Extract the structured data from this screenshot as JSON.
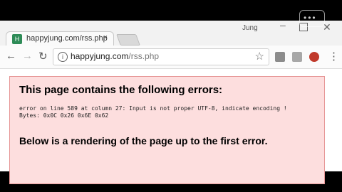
{
  "tab": {
    "favicon": "H",
    "title": "happyjung.com/rss.php",
    "close": "×"
  },
  "window": {
    "profile": "Jung",
    "minimize": "–",
    "close": "✕"
  },
  "nav": {
    "back": "←",
    "forward": "→",
    "reload": "↻"
  },
  "omnibox": {
    "info": "i",
    "host": "happyjung.com",
    "path": "/rss.php",
    "star": "☆"
  },
  "menu": "⋮",
  "error": {
    "heading": "This page contains the following errors:",
    "detail": "error on line 589 at column 27: Input is not proper UTF-8, indicate encoding !\nBytes: 0x0C 0x26 0x6E 0x62",
    "rendering": "Below is a rendering of the page up to the first error."
  },
  "watermark": "•••",
  "colors": {
    "error_bg": "#fddede",
    "error_border": "#e69595"
  }
}
